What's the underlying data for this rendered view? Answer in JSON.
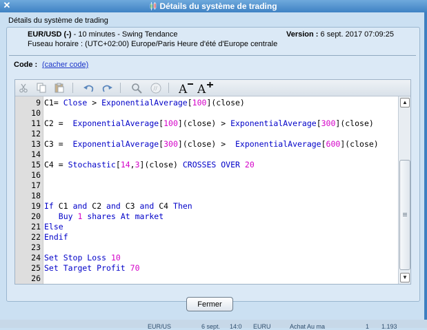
{
  "window": {
    "title": "Détails du système de trading",
    "close_glyph": "✕"
  },
  "group_title": "Détails du système de trading",
  "info": {
    "instrument": "EUR/USD (-)",
    "instrument_suffix": " - 10 minutes - Swing Tendance",
    "timezone": "Fuseau horaire : (UTC+02:00) Europe/Paris Heure d'été d'Europe centrale",
    "version_label": "Version :",
    "version_value": " 6 sept. 2017 07:09:25"
  },
  "code_section": {
    "label": "Code :",
    "toggle_link": "(cacher code)"
  },
  "toolbar": {
    "icons": [
      "cut-icon",
      "copy-icon",
      "paste-icon",
      "undo-icon",
      "redo-icon",
      "search-icon",
      "comment-icon",
      "decrease-font-icon",
      "increase-font-icon"
    ]
  },
  "editor": {
    "line_numbers": [
      "9",
      "10",
      "11",
      "12",
      "13",
      "14",
      "15",
      "16",
      "17",
      "18",
      "19",
      "20",
      "21",
      "22",
      "23",
      "24",
      "25",
      "26"
    ],
    "lines": [
      [
        {
          "t": "C1= ",
          "c": "txt"
        },
        {
          "t": "Close",
          "c": "kw"
        },
        {
          "t": " > ",
          "c": "txt"
        },
        {
          "t": "ExponentialAverage",
          "c": "kw"
        },
        {
          "t": "[",
          "c": "txt"
        },
        {
          "t": "100",
          "c": "num"
        },
        {
          "t": "](close)",
          "c": "txt"
        }
      ],
      [],
      [
        {
          "t": "C2 =  ",
          "c": "txt"
        },
        {
          "t": "ExponentialAverage",
          "c": "kw"
        },
        {
          "t": "[",
          "c": "txt"
        },
        {
          "t": "100",
          "c": "num"
        },
        {
          "t": "](close) > ",
          "c": "txt"
        },
        {
          "t": "ExponentialAverage",
          "c": "kw"
        },
        {
          "t": "[",
          "c": "txt"
        },
        {
          "t": "300",
          "c": "num"
        },
        {
          "t": "](close)",
          "c": "txt"
        }
      ],
      [],
      [
        {
          "t": "C3 =  ",
          "c": "txt"
        },
        {
          "t": "ExponentialAverage",
          "c": "kw"
        },
        {
          "t": "[",
          "c": "txt"
        },
        {
          "t": "300",
          "c": "num"
        },
        {
          "t": "](close) >  ",
          "c": "txt"
        },
        {
          "t": "ExponentialAverage",
          "c": "kw"
        },
        {
          "t": "[",
          "c": "txt"
        },
        {
          "t": "600",
          "c": "num"
        },
        {
          "t": "](close)",
          "c": "txt"
        }
      ],
      [],
      [
        {
          "t": "C4 = ",
          "c": "txt"
        },
        {
          "t": "Stochastic",
          "c": "kw"
        },
        {
          "t": "[",
          "c": "txt"
        },
        {
          "t": "14",
          "c": "num"
        },
        {
          "t": ",",
          "c": "txt"
        },
        {
          "t": "3",
          "c": "num"
        },
        {
          "t": "](close) ",
          "c": "txt"
        },
        {
          "t": "CROSSES OVER",
          "c": "kw"
        },
        {
          "t": " ",
          "c": "txt"
        },
        {
          "t": "20",
          "c": "num"
        }
      ],
      [],
      [],
      [],
      [
        {
          "t": "If",
          "c": "kw"
        },
        {
          "t": " C1 ",
          "c": "txt"
        },
        {
          "t": "and",
          "c": "kw"
        },
        {
          "t": " C2 ",
          "c": "txt"
        },
        {
          "t": "and",
          "c": "kw"
        },
        {
          "t": " C3 ",
          "c": "txt"
        },
        {
          "t": "and",
          "c": "kw"
        },
        {
          "t": " C4 ",
          "c": "txt"
        },
        {
          "t": "Then",
          "c": "kw"
        }
      ],
      [
        {
          "t": "   ",
          "c": "txt"
        },
        {
          "t": "Buy",
          "c": "kw"
        },
        {
          "t": " ",
          "c": "txt"
        },
        {
          "t": "1",
          "c": "num"
        },
        {
          "t": " ",
          "c": "txt"
        },
        {
          "t": "shares At market",
          "c": "kw"
        }
      ],
      [
        {
          "t": "Else",
          "c": "kw"
        }
      ],
      [
        {
          "t": "Endif",
          "c": "kw"
        }
      ],
      [],
      [
        {
          "t": "Set Stop Loss",
          "c": "kw"
        },
        {
          "t": " ",
          "c": "txt"
        },
        {
          "t": "10",
          "c": "num"
        }
      ],
      [
        {
          "t": "Set Target Profit",
          "c": "kw"
        },
        {
          "t": " ",
          "c": "txt"
        },
        {
          "t": "70",
          "c": "num"
        }
      ],
      []
    ]
  },
  "close_button": "Fermer",
  "taskbar": [
    "EUR/US",
    "6 sept.",
    "14:0",
    "EURU",
    "Achat Au ma",
    "1",
    "1.193"
  ],
  "colors": {
    "keyword": "#0000c8",
    "number": "#d400c8",
    "title_bar": "#3f82c4"
  }
}
